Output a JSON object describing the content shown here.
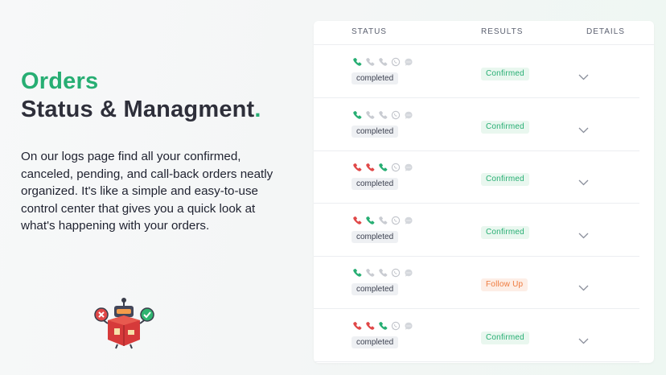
{
  "hero": {
    "title_line1": "Orders",
    "title_line2": "Status & Managment",
    "title_dot": ".",
    "description": "On our logs page find all your confirmed, canceled, pending, and call-back orders neatly organized. It's like a simple and easy-to-use control center that gives you a quick look at what's happening with your orders."
  },
  "table": {
    "headers": {
      "status": "STATUS",
      "results": "RESULTS",
      "details": "DETAILS"
    },
    "rows": [
      {
        "calls": [
          "green",
          "grey",
          "grey"
        ],
        "status": "completed",
        "result": "Confirmed",
        "result_type": "confirmed"
      },
      {
        "calls": [
          "green",
          "grey",
          "grey"
        ],
        "status": "completed",
        "result": "Confirmed",
        "result_type": "confirmed"
      },
      {
        "calls": [
          "red",
          "red",
          "green"
        ],
        "status": "completed",
        "result": "Confirmed",
        "result_type": "confirmed"
      },
      {
        "calls": [
          "red",
          "green",
          "grey"
        ],
        "status": "completed",
        "result": "Confirmed",
        "result_type": "confirmed"
      },
      {
        "calls": [
          "green",
          "grey",
          "grey"
        ],
        "status": "completed",
        "result": "Follow Up",
        "result_type": "follow"
      },
      {
        "calls": [
          "red",
          "red",
          "green"
        ],
        "status": "completed",
        "result": "Confirmed",
        "result_type": "confirmed"
      }
    ]
  },
  "colors": {
    "accent": "#27ae73",
    "call_green": "#27ae73",
    "call_red": "#e04848",
    "call_grey": "#c9ccd2",
    "follow_up": "#ee7a3d"
  },
  "icons": [
    "phone-icon",
    "whatsapp-icon",
    "sms-icon",
    "chevron-down-icon",
    "robot-illustration"
  ]
}
